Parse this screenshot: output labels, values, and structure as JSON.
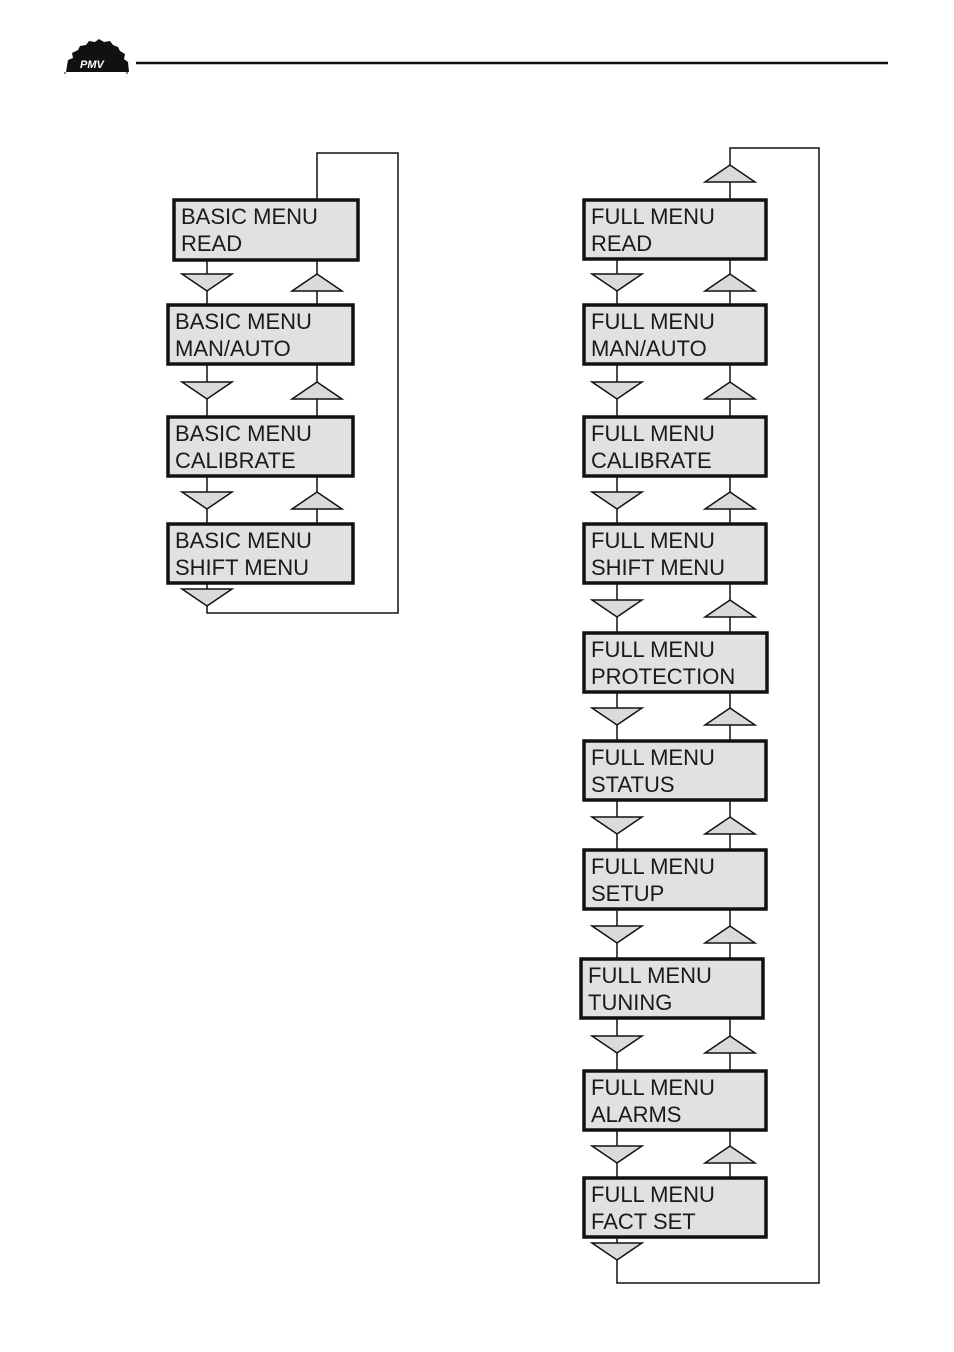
{
  "header": {
    "logo_text": "PMV"
  },
  "colors": {
    "box_fill": "#e0e1e3",
    "line": "#111111",
    "arrow_fill": "#d9dadc"
  },
  "basic_menu": {
    "items": [
      {
        "line1": "BASIC MENU",
        "line2": "READ"
      },
      {
        "line1": "BASIC MENU",
        "line2": "MAN/AUTO"
      },
      {
        "line1": "BASIC MENU",
        "line2": " CALIBRATE"
      },
      {
        "line1": "BASIC MENU",
        "line2": "SHIFT MENU"
      }
    ]
  },
  "full_menu": {
    "items": [
      {
        "line1": "FULL MENU",
        "line2": "READ"
      },
      {
        "line1": "FULL MENU",
        "line2": "MAN/AUTO"
      },
      {
        "line1": "FULL MENU",
        "line2": " CALIBRATE"
      },
      {
        "line1": "FULL MENU",
        "line2": "SHIFT MENU"
      },
      {
        "line1": "FULL MENU",
        "line2": "PROTECTION"
      },
      {
        "line1": "FULL MENU",
        "line2": "STATUS"
      },
      {
        "line1": "FULL MENU",
        "line2": "SETUP"
      },
      {
        "line1": "FULL MENU",
        "line2": "TUNING"
      },
      {
        "line1": "FULL MENU",
        "line2": "ALARMS"
      },
      {
        "line1": "FULL MENU",
        "line2": "FACT SET"
      }
    ]
  }
}
